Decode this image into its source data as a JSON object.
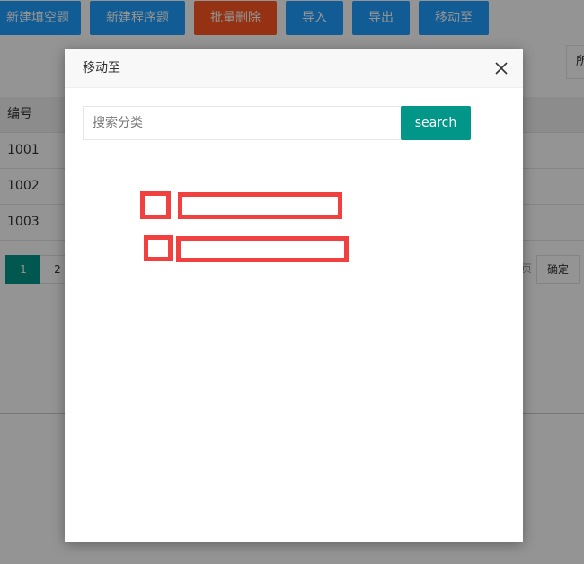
{
  "toolbar": {
    "buttons": [
      "新建填空题",
      "新建程序题",
      "批量删除",
      "导入",
      "导出",
      "移动至"
    ]
  },
  "filter": {
    "label": "所"
  },
  "table": {
    "header": "编号",
    "rows": [
      "1001",
      "1002",
      "1003"
    ]
  },
  "pager": {
    "pages": [
      "1",
      "2"
    ],
    "suffix": "页",
    "confirm": "确定"
  },
  "modal": {
    "title": "移动至",
    "search_placeholder": "搜索分类",
    "search_label": "search",
    "tree_items": [
      {
        "id": "item-1"
      },
      {
        "id": "item-2"
      }
    ]
  },
  "colors": {
    "primary": "#1e9fff",
    "danger": "#ff5722",
    "accent": "#009688",
    "highlight": "#f04040"
  }
}
